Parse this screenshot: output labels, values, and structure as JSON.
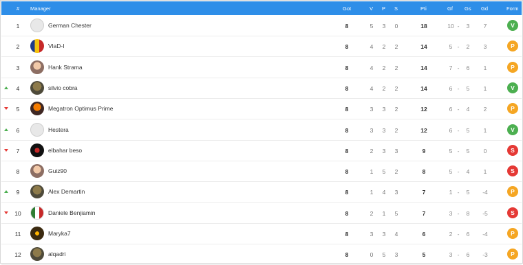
{
  "header": {
    "rank": "#",
    "manager": "Manager",
    "got": "Got",
    "v": "V",
    "p": "P",
    "s": "S",
    "pti": "Pti",
    "gf": "Gf",
    "gs": "Gs",
    "gd": "Gd",
    "form": "Form"
  },
  "colors": {
    "header_bg": "#2e8ee8",
    "trend_up": "#4caf50",
    "trend_down": "#e53935",
    "form_V": "#4caf50",
    "form_P": "#f5a623",
    "form_S": "#e53935"
  },
  "rows": [
    {
      "trend": "",
      "rank": "1",
      "name": "German Chester",
      "avatar": "ghost-avatar",
      "got": "8",
      "v": "5",
      "p": "3",
      "s": "0",
      "pti": "18",
      "gf": "10",
      "dash": "-",
      "gs": "3",
      "gd": "7",
      "form": "V"
    },
    {
      "trend": "",
      "rank": "2",
      "name": "VlaD-I",
      "avatar": "flag-avatar",
      "got": "8",
      "v": "4",
      "p": "2",
      "s": "2",
      "pti": "14",
      "gf": "5",
      "dash": "-",
      "gs": "2",
      "gd": "3",
      "form": "P"
    },
    {
      "trend": "",
      "rank": "3",
      "name": "Hank Strama",
      "avatar": "person-avatar",
      "got": "8",
      "v": "4",
      "p": "2",
      "s": "2",
      "pti": "14",
      "gf": "7",
      "dash": "-",
      "gs": "6",
      "gd": "1",
      "form": "P"
    },
    {
      "trend": "up",
      "rank": "4",
      "name": "silvio cobra",
      "avatar": "photo-avatar",
      "got": "8",
      "v": "4",
      "p": "2",
      "s": "2",
      "pti": "14",
      "gf": "6",
      "dash": "-",
      "gs": "5",
      "gd": "1",
      "form": "V"
    },
    {
      "trend": "down",
      "rank": "5",
      "name": "Megatron Optimus Prime",
      "avatar": "robot-avatar",
      "got": "8",
      "v": "3",
      "p": "3",
      "s": "2",
      "pti": "12",
      "gf": "6",
      "dash": "-",
      "gs": "4",
      "gd": "2",
      "form": "P"
    },
    {
      "trend": "up",
      "rank": "6",
      "name": "Hestera",
      "avatar": "ghost-avatar",
      "got": "8",
      "v": "3",
      "p": "3",
      "s": "2",
      "pti": "12",
      "gf": "6",
      "dash": "-",
      "gs": "5",
      "gd": "1",
      "form": "V"
    },
    {
      "trend": "down",
      "rank": "7",
      "name": "elbahar beso",
      "avatar": "badge-avatar",
      "got": "8",
      "v": "2",
      "p": "3",
      "s": "3",
      "pti": "9",
      "gf": "5",
      "dash": "-",
      "gs": "5",
      "gd": "0",
      "form": "S"
    },
    {
      "trend": "",
      "rank": "8",
      "name": "Guiz90",
      "avatar": "person-avatar",
      "got": "8",
      "v": "1",
      "p": "5",
      "s": "2",
      "pti": "8",
      "gf": "5",
      "dash": "-",
      "gs": "4",
      "gd": "1",
      "form": "S"
    },
    {
      "trend": "up",
      "rank": "9",
      "name": "Alex Demartin",
      "avatar": "photo-avatar",
      "got": "8",
      "v": "1",
      "p": "4",
      "s": "3",
      "pti": "7",
      "gf": "1",
      "dash": "-",
      "gs": "5",
      "gd": "-4",
      "form": "P"
    },
    {
      "trend": "down",
      "rank": "10",
      "name": "Daniele Benjiamin",
      "avatar": "flag-italy-avatar",
      "got": "8",
      "v": "2",
      "p": "1",
      "s": "5",
      "pti": "7",
      "gf": "3",
      "dash": "-",
      "gs": "8",
      "gd": "-5",
      "form": "S"
    },
    {
      "trend": "",
      "rank": "11",
      "name": "Maryka7",
      "avatar": "dark-avatar",
      "got": "8",
      "v": "3",
      "p": "3",
      "s": "4",
      "pti": "6",
      "gf": "2",
      "dash": "-",
      "gs": "6",
      "gd": "-4",
      "form": "P"
    },
    {
      "trend": "",
      "rank": "12",
      "name": "alqadri",
      "avatar": "photo-avatar",
      "got": "8",
      "v": "0",
      "p": "5",
      "s": "3",
      "pti": "5",
      "gf": "3",
      "dash": "-",
      "gs": "6",
      "gd": "-3",
      "form": "P"
    }
  ]
}
